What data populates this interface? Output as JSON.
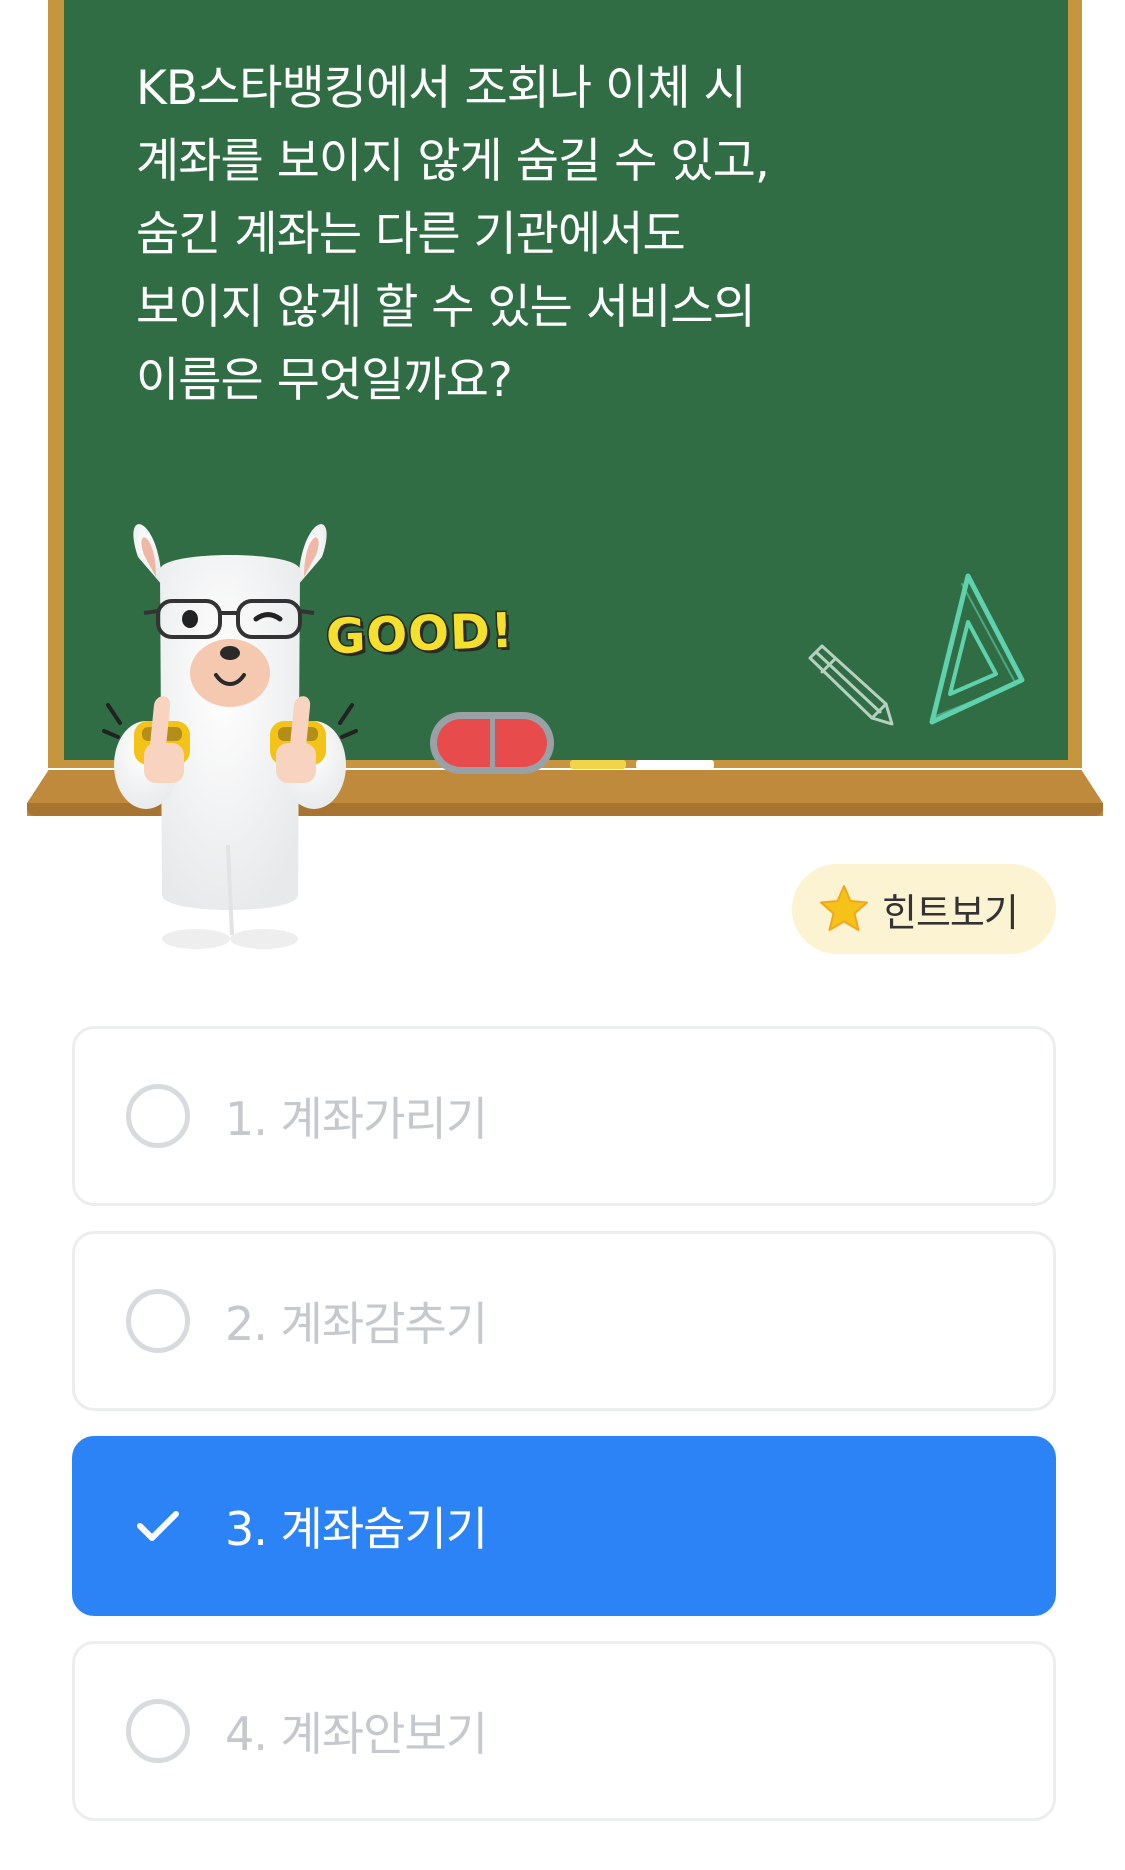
{
  "quiz": {
    "question": "KB스타뱅킹에서 조회나 이체 시\n계좌를 보이지 않게 숨길 수 있고,\n숨긴 계좌는 다른 기관에서도\n보이지 않게 할 수 있는 서비스의\n이름은 무엇일까요?",
    "mascot_sticker": "GOOD!",
    "hint_button_label": "힌트보기",
    "selected_index": 2,
    "options": [
      {
        "label": "1. 계좌가리기",
        "selected": false
      },
      {
        "label": "2. 계좌감추기",
        "selected": false
      },
      {
        "label": "3. 계좌숨기기",
        "selected": true
      },
      {
        "label": "4. 계좌안보기",
        "selected": false
      }
    ]
  },
  "colors": {
    "board_green": "#306d45",
    "board_frame": "#c8953f",
    "selected_blue": "#2b83f6",
    "hint_bg": "#fbf3d2",
    "star_yellow": "#f6c21a",
    "unselected_text": "#c5c8cc"
  },
  "icons": {
    "hint": "star-icon",
    "selected": "check-icon",
    "unselected": "radio-circle-icon"
  }
}
